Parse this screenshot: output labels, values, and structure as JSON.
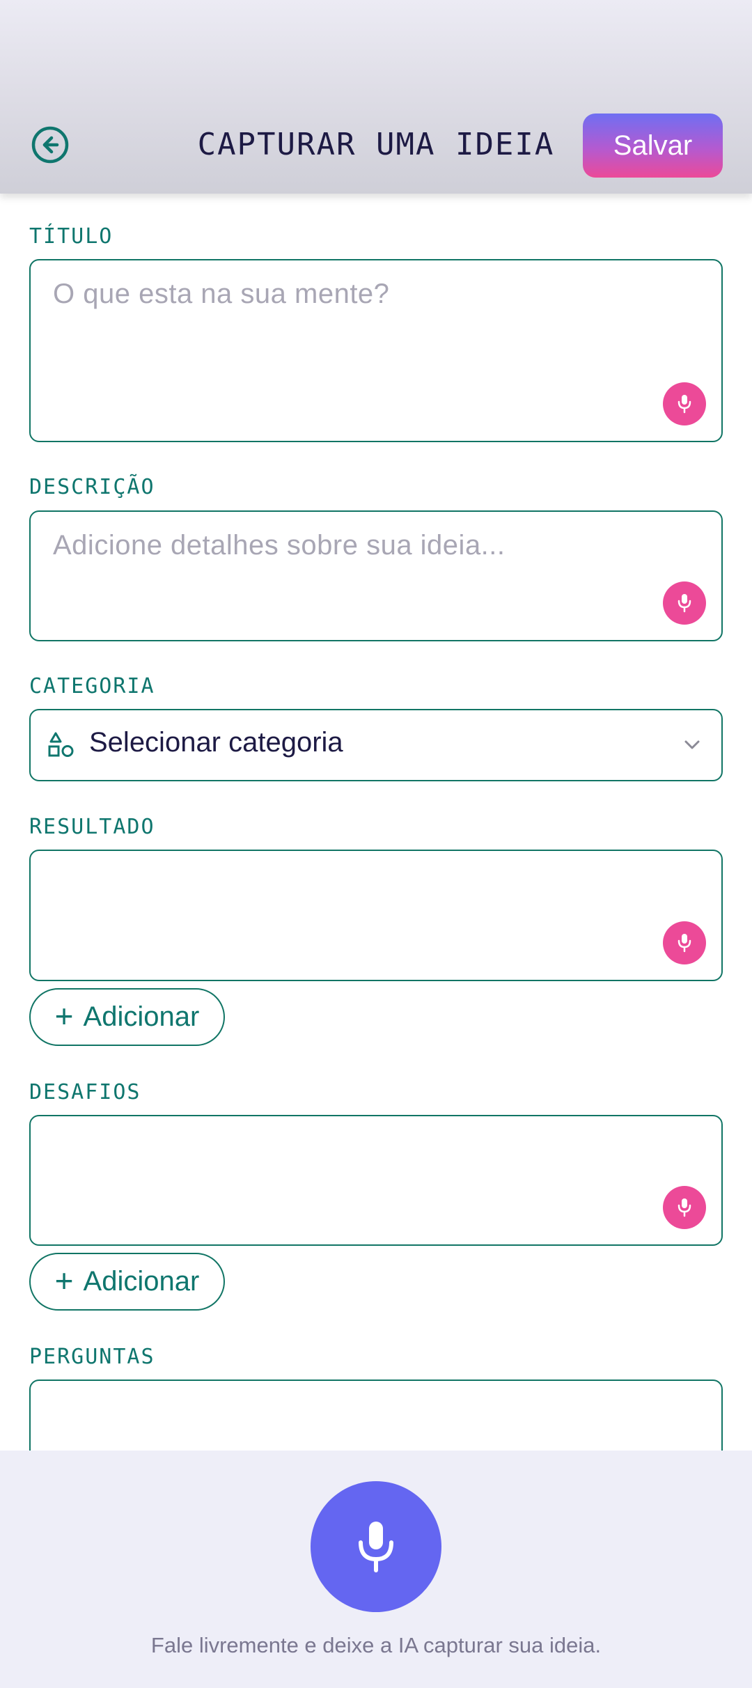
{
  "header": {
    "title": "CAPTURAR UMA IDEIA",
    "save_label": "Salvar",
    "back_icon": "arrow-left-circle-icon"
  },
  "form": {
    "title": {
      "label": "TÍTULO",
      "placeholder": "O que esta na sua mente?"
    },
    "description": {
      "label": "DESCRIÇÃO",
      "placeholder": "Adicione detalhes sobre sua ideia..."
    },
    "category": {
      "label": "CATEGORIA",
      "selected": "Selecionar categoria",
      "icon": "shapes-icon"
    },
    "result": {
      "label": "RESULTADO",
      "add_label": "Adicionar"
    },
    "challenges": {
      "label": "DESAFIOS",
      "add_label": "Adicionar"
    },
    "questions": {
      "label": "PERGUNTAS"
    }
  },
  "bottom": {
    "hint": "Fale livremente e deixe a IA capturar sua ideia.",
    "mic_icon": "microphone-icon"
  },
  "colors": {
    "accent_teal": "#0f766e",
    "mic_pink": "#ec4a98",
    "mic_indigo": "#6466f1",
    "title_text": "#1d1a44"
  }
}
